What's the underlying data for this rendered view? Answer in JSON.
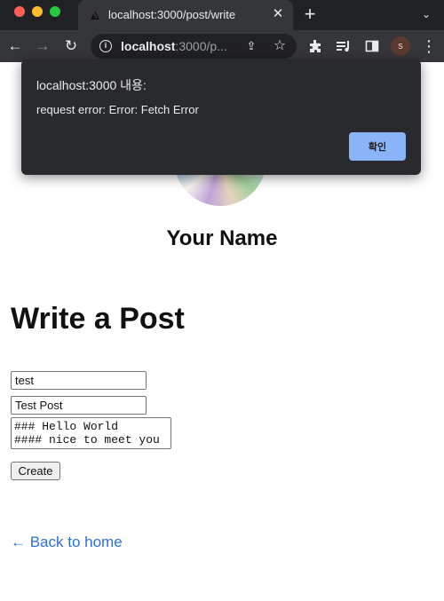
{
  "browser": {
    "tab": {
      "title": "localhost:3000/post/write",
      "close_icon": "close-icon"
    },
    "new_tab_icon": "plus-icon",
    "tab_menu_icon": "chevron-down-icon",
    "address_bar": {
      "host": "localhost",
      "path": ":3000/p..."
    },
    "profile_initial": "s"
  },
  "page": {
    "profile_name": "Your Name",
    "heading": "Write a Post",
    "form": {
      "id_value": "test",
      "title_value": "Test Post",
      "content_value": "### Hello World\n#### nice to meet you",
      "create_label": "Create"
    },
    "back_link": "← Back to home"
  },
  "alert": {
    "title": "localhost:3000 내용:",
    "message": "request error: Error: Fetch Error",
    "ok_label": "확인"
  },
  "colors": {
    "link": "#2f6fd6",
    "dialog_button": "#8ab4f8",
    "chrome_dark": "#202124"
  }
}
